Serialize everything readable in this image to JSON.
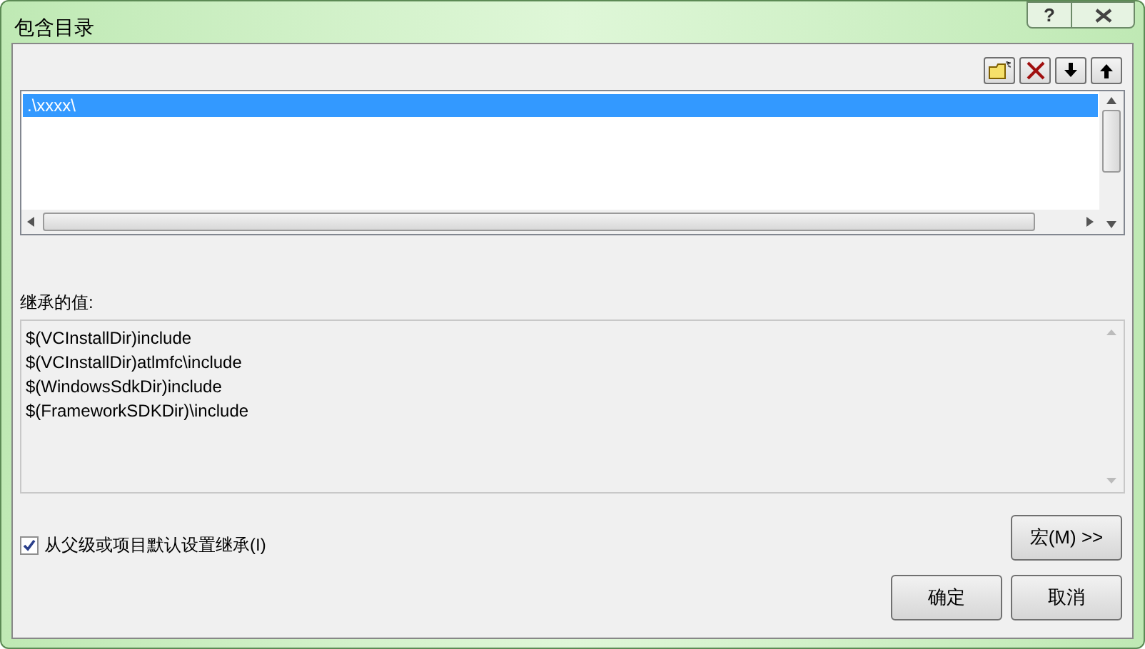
{
  "window": {
    "title": "包含目录",
    "help": "?"
  },
  "directories": [
    {
      "path": ".\\xxxx\\",
      "selected": true
    }
  ],
  "inherited": {
    "label": "继承的值:",
    "values": [
      "$(VCInstallDir)include",
      "$(VCInstallDir)atlmfc\\include",
      "$(WindowsSdkDir)include",
      "$(FrameworkSDKDir)\\include"
    ]
  },
  "inherit_checkbox": {
    "label": "从父级或项目默认设置继承(I)",
    "checked": true
  },
  "macros_button": "宏(M) >>",
  "buttons": [
    "确定",
    "取消"
  ]
}
